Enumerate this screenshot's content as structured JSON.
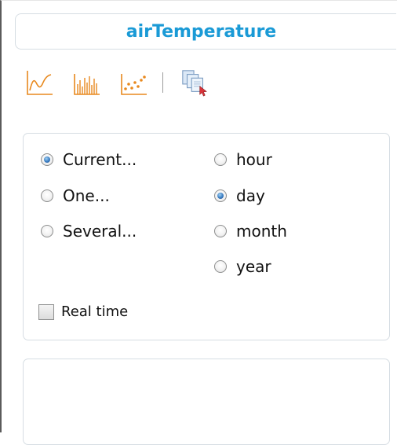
{
  "header": {
    "title": "airTemperature"
  },
  "toolbar": {
    "buttons": [
      {
        "icon": "line-chart-icon"
      },
      {
        "icon": "bar-chart-icon"
      },
      {
        "icon": "scatter-chart-icon"
      },
      {
        "icon": "copy-documents-icon"
      }
    ],
    "icon_color": "#e8891e"
  },
  "range_options": [
    "Current...",
    "One...",
    "Several..."
  ],
  "range_selected": "Current...",
  "period_options": [
    "hour",
    "day",
    "month",
    "year"
  ],
  "period_selected": "day",
  "realtime": {
    "label": "Real time",
    "checked": false
  },
  "colors": {
    "title": "#1a9ad6",
    "border": "#d6dde3",
    "radio_selected": "#3a7cc1"
  }
}
